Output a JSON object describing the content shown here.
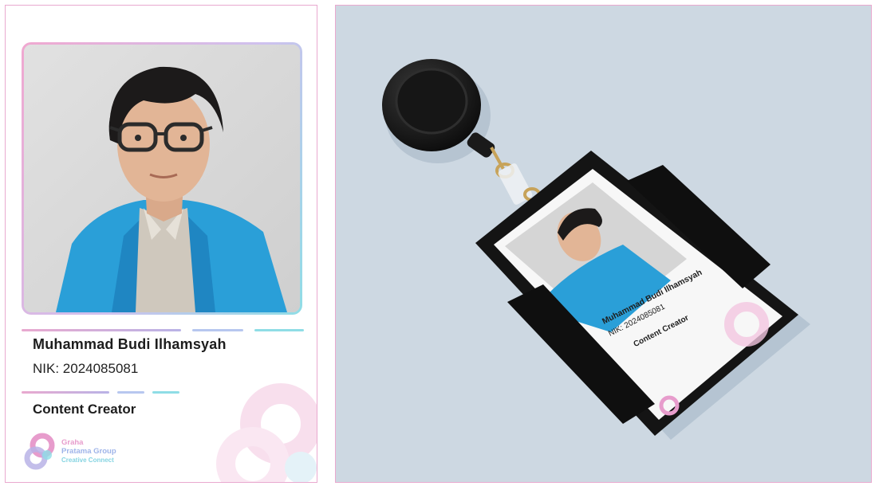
{
  "card": {
    "name": "Muhammad Budi Ilhamsyah",
    "nik": "NIK: 2024085081",
    "role": "Content Creator",
    "photo_icon": "person-portrait-icon",
    "colors": {
      "pink": "#e9a9cf",
      "lavender": "#b9b3e6",
      "blue": "#9fb4e9",
      "cyan": "#8fdde6"
    }
  },
  "brand": {
    "line1": "Graha",
    "line2": "Pratama Group",
    "tagline": "Creative Connect",
    "logo_icon": "graha-pratama-logo-icon"
  },
  "mockup": {
    "name": "Muhammad Budi Ilhamsyah",
    "nik": "NIK: 2024085081",
    "role": "Content Creator",
    "badge_reel_icon": "badge-reel-icon"
  }
}
